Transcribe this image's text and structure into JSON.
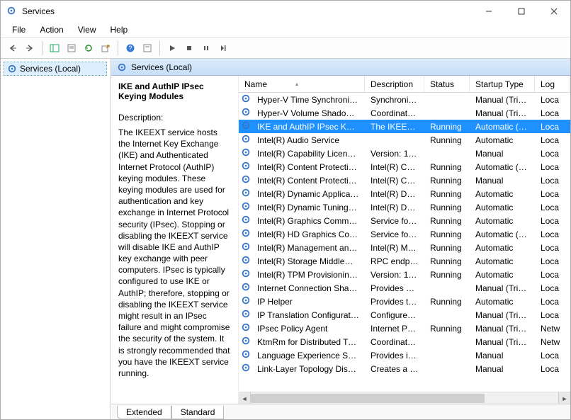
{
  "window": {
    "title": "Services"
  },
  "menu": {
    "file": "File",
    "action": "Action",
    "view": "View",
    "help": "Help"
  },
  "tree": {
    "root": "Services (Local)"
  },
  "panel": {
    "heading": "Services (Local)"
  },
  "detail": {
    "title": "IKE and AuthIP IPsec Keying Modules",
    "desc_label": "Description:",
    "desc": "The IKEEXT service hosts the Internet Key Exchange (IKE) and Authenticated Internet Protocol (AuthIP) keying modules. These keying modules are used for authentication and key exchange in Internet Protocol security (IPsec). Stopping or disabling the IKEEXT service will disable IKE and AuthIP key exchange with peer computers. IPsec is typically configured to use IKE or AuthIP; therefore, stopping or disabling the IKEEXT service might result in an IPsec failure and might compromise the security of the system. It is strongly recommended that you have the IKEEXT service running."
  },
  "columns": {
    "name": "Name",
    "desc": "Description",
    "status": "Status",
    "startup": "Startup Type",
    "logon": "Log"
  },
  "services": [
    {
      "name": "Hyper-V Time Synchronizati...",
      "desc": "Synchronize...",
      "status": "",
      "startup": "Manual (Trig...",
      "logon": "Loca",
      "sel": false
    },
    {
      "name": "Hyper-V Volume Shadow C...",
      "desc": "Coordinates...",
      "status": "",
      "startup": "Manual (Trig...",
      "logon": "Loca",
      "sel": false
    },
    {
      "name": "IKE and AuthIP IPsec Keying...",
      "desc": "The IKEEXT ...",
      "status": "Running",
      "startup": "Automatic (T...",
      "logon": "Loca",
      "sel": true
    },
    {
      "name": "Intel(R) Audio Service",
      "desc": "",
      "status": "Running",
      "startup": "Automatic",
      "logon": "Loca",
      "sel": false
    },
    {
      "name": "Intel(R) Capability Licensing...",
      "desc": "Version: 1.6...",
      "status": "",
      "startup": "Manual",
      "logon": "Loca",
      "sel": false
    },
    {
      "name": "Intel(R) Content Protection ...",
      "desc": "Intel(R) Con...",
      "status": "Running",
      "startup": "Automatic (T...",
      "logon": "Loca",
      "sel": false
    },
    {
      "name": "Intel(R) Content Protection ...",
      "desc": "Intel(R) Con...",
      "status": "Running",
      "startup": "Manual",
      "logon": "Loca",
      "sel": false
    },
    {
      "name": "Intel(R) Dynamic Applicatio...",
      "desc": "Intel(R) Dyn...",
      "status": "Running",
      "startup": "Automatic",
      "logon": "Loca",
      "sel": false
    },
    {
      "name": "Intel(R) Dynamic Tuning ser...",
      "desc": "Intel(R) Dyn...",
      "status": "Running",
      "startup": "Automatic",
      "logon": "Loca",
      "sel": false
    },
    {
      "name": "Intel(R) Graphics Command...",
      "desc": "Service for I...",
      "status": "Running",
      "startup": "Automatic",
      "logon": "Loca",
      "sel": false
    },
    {
      "name": "Intel(R) HD Graphics Contro...",
      "desc": "Service for I...",
      "status": "Running",
      "startup": "Automatic (T...",
      "logon": "Loca",
      "sel": false
    },
    {
      "name": "Intel(R) Management and S...",
      "desc": "Intel(R) Ma...",
      "status": "Running",
      "startup": "Automatic",
      "logon": "Loca",
      "sel": false
    },
    {
      "name": "Intel(R) Storage Middleware...",
      "desc": "RPC endpoi...",
      "status": "Running",
      "startup": "Automatic",
      "logon": "Loca",
      "sel": false
    },
    {
      "name": "Intel(R) TPM Provisioning S...",
      "desc": "Version: 1.6...",
      "status": "Running",
      "startup": "Automatic",
      "logon": "Loca",
      "sel": false
    },
    {
      "name": "Internet Connection Sharin...",
      "desc": "Provides ne...",
      "status": "",
      "startup": "Manual (Trig...",
      "logon": "Loca",
      "sel": false
    },
    {
      "name": "IP Helper",
      "desc": "Provides tu...",
      "status": "Running",
      "startup": "Automatic",
      "logon": "Loca",
      "sel": false
    },
    {
      "name": "IP Translation Configuratio...",
      "desc": "Configures ...",
      "status": "",
      "startup": "Manual (Trig...",
      "logon": "Loca",
      "sel": false
    },
    {
      "name": "IPsec Policy Agent",
      "desc": "Internet Pro...",
      "status": "Running",
      "startup": "Manual (Trig...",
      "logon": "Netw",
      "sel": false
    },
    {
      "name": "KtmRm for Distributed Tran...",
      "desc": "Coordinates...",
      "status": "",
      "startup": "Manual (Trig...",
      "logon": "Netw",
      "sel": false
    },
    {
      "name": "Language Experience Service",
      "desc": "Provides inf...",
      "status": "",
      "startup": "Manual",
      "logon": "Loca",
      "sel": false
    },
    {
      "name": "Link-Layer Topology Discov...",
      "desc": "Creates a N...",
      "status": "",
      "startup": "Manual",
      "logon": "Loca",
      "sel": false
    }
  ],
  "tabs": {
    "extended": "Extended",
    "standard": "Standard"
  }
}
